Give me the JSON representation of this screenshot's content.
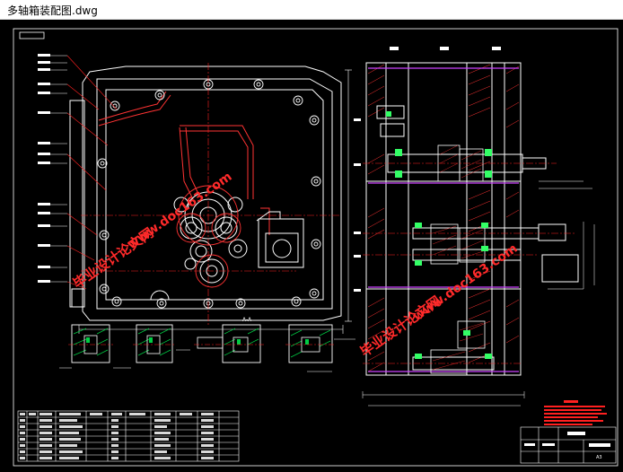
{
  "window": {
    "title": "多轴箱装配图.dwg"
  },
  "drawing": {
    "background": "#000000",
    "colors": {
      "outline": "#ffffff",
      "housing": "#ff3333",
      "centerline": "#ff2020",
      "hatch": "#00cc44",
      "shaft": "#ffffff",
      "bearing": "#33ff66",
      "spacer": "#cc44ff",
      "dimension": "#ffffff",
      "notes": "#ff2020",
      "watermark": "#ff2a2a"
    },
    "watermark": {
      "cn": "毕业设计论文网",
      "url": "www.doc163.com"
    },
    "title_block": {
      "drawing_no": "A3"
    },
    "section_label": "A-A"
  }
}
